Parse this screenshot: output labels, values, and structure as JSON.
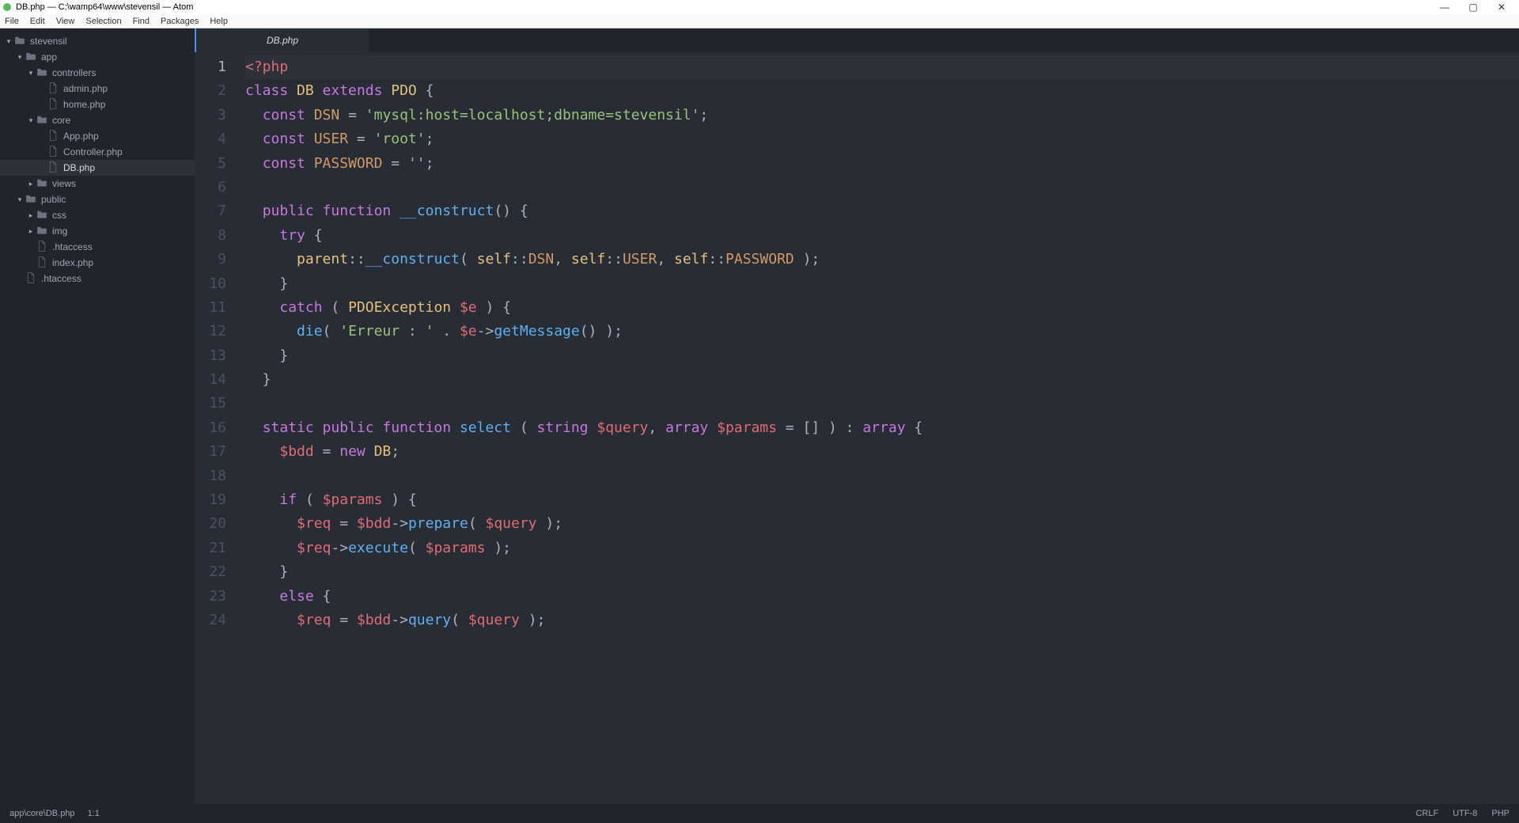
{
  "window": {
    "title": "DB.php — C:\\wamp64\\www\\stevensil — Atom"
  },
  "menu": [
    "File",
    "Edit",
    "View",
    "Selection",
    "Find",
    "Packages",
    "Help"
  ],
  "tree": [
    {
      "depth": 0,
      "kind": "folder",
      "expanded": true,
      "label": "stevensil"
    },
    {
      "depth": 1,
      "kind": "folder",
      "expanded": true,
      "label": "app"
    },
    {
      "depth": 2,
      "kind": "folder",
      "expanded": true,
      "label": "controllers"
    },
    {
      "depth": 3,
      "kind": "file",
      "label": "admin.php"
    },
    {
      "depth": 3,
      "kind": "file",
      "label": "home.php"
    },
    {
      "depth": 2,
      "kind": "folder",
      "expanded": true,
      "label": "core"
    },
    {
      "depth": 3,
      "kind": "file",
      "label": "App.php"
    },
    {
      "depth": 3,
      "kind": "file",
      "label": "Controller.php"
    },
    {
      "depth": 3,
      "kind": "file",
      "label": "DB.php",
      "active": true
    },
    {
      "depth": 2,
      "kind": "folder",
      "expanded": false,
      "label": "views"
    },
    {
      "depth": 1,
      "kind": "folder",
      "expanded": true,
      "label": "public"
    },
    {
      "depth": 2,
      "kind": "folder",
      "expanded": false,
      "label": "css"
    },
    {
      "depth": 2,
      "kind": "folder",
      "expanded": false,
      "label": "img"
    },
    {
      "depth": 2,
      "kind": "file",
      "label": ".htaccess"
    },
    {
      "depth": 2,
      "kind": "file",
      "label": "index.php"
    },
    {
      "depth": 1,
      "kind": "file",
      "label": ".htaccess"
    }
  ],
  "tabs": [
    {
      "label": "DB.php",
      "active": true
    }
  ],
  "editor": {
    "current_line": 1,
    "line_count": 24,
    "lines": [
      [
        {
          "t": "<?php",
          "c": "c-php"
        }
      ],
      [
        {
          "t": "class ",
          "c": "c-key"
        },
        {
          "t": "DB ",
          "c": "c-cls"
        },
        {
          "t": "extends ",
          "c": "c-key"
        },
        {
          "t": "PDO ",
          "c": "c-cls"
        },
        {
          "t": "{",
          "c": "c-punc"
        }
      ],
      [
        {
          "t": "  ",
          "c": ""
        },
        {
          "t": "const ",
          "c": "c-key"
        },
        {
          "t": "DSN ",
          "c": "c-const"
        },
        {
          "t": "= ",
          "c": "c-op"
        },
        {
          "t": "'mysql:host=localhost;dbname=stevensil'",
          "c": "c-str"
        },
        {
          "t": ";",
          "c": "c-punc"
        }
      ],
      [
        {
          "t": "  ",
          "c": ""
        },
        {
          "t": "const ",
          "c": "c-key"
        },
        {
          "t": "USER ",
          "c": "c-const"
        },
        {
          "t": "= ",
          "c": "c-op"
        },
        {
          "t": "'root'",
          "c": "c-str"
        },
        {
          "t": ";",
          "c": "c-punc"
        }
      ],
      [
        {
          "t": "  ",
          "c": ""
        },
        {
          "t": "const ",
          "c": "c-key"
        },
        {
          "t": "PASSWORD ",
          "c": "c-const"
        },
        {
          "t": "= ",
          "c": "c-op"
        },
        {
          "t": "''",
          "c": "c-str"
        },
        {
          "t": ";",
          "c": "c-punc"
        }
      ],
      [
        {
          "t": "",
          "c": ""
        }
      ],
      [
        {
          "t": "  ",
          "c": ""
        },
        {
          "t": "public ",
          "c": "c-key"
        },
        {
          "t": "function ",
          "c": "c-key"
        },
        {
          "t": "__construct",
          "c": "c-fn"
        },
        {
          "t": "() {",
          "c": "c-punc"
        }
      ],
      [
        {
          "t": "    ",
          "c": ""
        },
        {
          "t": "try ",
          "c": "c-key"
        },
        {
          "t": "{",
          "c": "c-punc"
        }
      ],
      [
        {
          "t": "      ",
          "c": ""
        },
        {
          "t": "parent",
          "c": "c-self"
        },
        {
          "t": "::",
          "c": "c-punc"
        },
        {
          "t": "__construct",
          "c": "c-fn"
        },
        {
          "t": "( ",
          "c": "c-punc"
        },
        {
          "t": "self",
          "c": "c-self"
        },
        {
          "t": "::",
          "c": "c-punc"
        },
        {
          "t": "DSN",
          "c": "c-const"
        },
        {
          "t": ", ",
          "c": "c-punc"
        },
        {
          "t": "self",
          "c": "c-self"
        },
        {
          "t": "::",
          "c": "c-punc"
        },
        {
          "t": "USER",
          "c": "c-const"
        },
        {
          "t": ", ",
          "c": "c-punc"
        },
        {
          "t": "self",
          "c": "c-self"
        },
        {
          "t": "::",
          "c": "c-punc"
        },
        {
          "t": "PASSWORD",
          "c": "c-const"
        },
        {
          "t": " );",
          "c": "c-punc"
        }
      ],
      [
        {
          "t": "    }",
          "c": "c-punc"
        }
      ],
      [
        {
          "t": "    ",
          "c": ""
        },
        {
          "t": "catch ",
          "c": "c-key"
        },
        {
          "t": "( ",
          "c": "c-punc"
        },
        {
          "t": "PDOException ",
          "c": "c-cls"
        },
        {
          "t": "$e",
          "c": "c-var"
        },
        {
          "t": " ) {",
          "c": "c-punc"
        }
      ],
      [
        {
          "t": "      ",
          "c": ""
        },
        {
          "t": "die",
          "c": "c-fn"
        },
        {
          "t": "( ",
          "c": "c-punc"
        },
        {
          "t": "'Erreur : '",
          "c": "c-str"
        },
        {
          "t": " . ",
          "c": "c-op"
        },
        {
          "t": "$e",
          "c": "c-var"
        },
        {
          "t": "->",
          "c": "c-op"
        },
        {
          "t": "getMessage",
          "c": "c-fn"
        },
        {
          "t": "() );",
          "c": "c-punc"
        }
      ],
      [
        {
          "t": "    }",
          "c": "c-punc"
        }
      ],
      [
        {
          "t": "  }",
          "c": "c-punc"
        }
      ],
      [
        {
          "t": "",
          "c": ""
        }
      ],
      [
        {
          "t": "  ",
          "c": ""
        },
        {
          "t": "static ",
          "c": "c-key"
        },
        {
          "t": "public ",
          "c": "c-key"
        },
        {
          "t": "function ",
          "c": "c-key"
        },
        {
          "t": "select ",
          "c": "c-fn"
        },
        {
          "t": "( ",
          "c": "c-punc"
        },
        {
          "t": "string ",
          "c": "c-key"
        },
        {
          "t": "$query",
          "c": "c-var"
        },
        {
          "t": ", ",
          "c": "c-punc"
        },
        {
          "t": "array ",
          "c": "c-key"
        },
        {
          "t": "$params",
          "c": "c-var"
        },
        {
          "t": " = [] ) : ",
          "c": "c-op"
        },
        {
          "t": "array ",
          "c": "c-key"
        },
        {
          "t": "{",
          "c": "c-punc"
        }
      ],
      [
        {
          "t": "    ",
          "c": ""
        },
        {
          "t": "$bdd",
          "c": "c-var"
        },
        {
          "t": " = ",
          "c": "c-op"
        },
        {
          "t": "new ",
          "c": "c-key"
        },
        {
          "t": "DB",
          "c": "c-cls"
        },
        {
          "t": ";",
          "c": "c-punc"
        }
      ],
      [
        {
          "t": "",
          "c": ""
        }
      ],
      [
        {
          "t": "    ",
          "c": ""
        },
        {
          "t": "if ",
          "c": "c-key"
        },
        {
          "t": "( ",
          "c": "c-punc"
        },
        {
          "t": "$params",
          "c": "c-var"
        },
        {
          "t": " ) {",
          "c": "c-punc"
        }
      ],
      [
        {
          "t": "      ",
          "c": ""
        },
        {
          "t": "$req",
          "c": "c-var"
        },
        {
          "t": " = ",
          "c": "c-op"
        },
        {
          "t": "$bdd",
          "c": "c-var"
        },
        {
          "t": "->",
          "c": "c-op"
        },
        {
          "t": "prepare",
          "c": "c-fn"
        },
        {
          "t": "( ",
          "c": "c-punc"
        },
        {
          "t": "$query",
          "c": "c-var"
        },
        {
          "t": " );",
          "c": "c-punc"
        }
      ],
      [
        {
          "t": "      ",
          "c": ""
        },
        {
          "t": "$req",
          "c": "c-var"
        },
        {
          "t": "->",
          "c": "c-op"
        },
        {
          "t": "execute",
          "c": "c-fn"
        },
        {
          "t": "( ",
          "c": "c-punc"
        },
        {
          "t": "$params",
          "c": "c-var"
        },
        {
          "t": " );",
          "c": "c-punc"
        }
      ],
      [
        {
          "t": "    }",
          "c": "c-punc"
        }
      ],
      [
        {
          "t": "    ",
          "c": ""
        },
        {
          "t": "else ",
          "c": "c-key"
        },
        {
          "t": "{",
          "c": "c-punc"
        }
      ],
      [
        {
          "t": "      ",
          "c": ""
        },
        {
          "t": "$req",
          "c": "c-var"
        },
        {
          "t": " = ",
          "c": "c-op"
        },
        {
          "t": "$bdd",
          "c": "c-var"
        },
        {
          "t": "->",
          "c": "c-op"
        },
        {
          "t": "query",
          "c": "c-fn"
        },
        {
          "t": "( ",
          "c": "c-punc"
        },
        {
          "t": "$query",
          "c": "c-var"
        },
        {
          "t": " );",
          "c": "c-punc"
        }
      ]
    ]
  },
  "status": {
    "path": "app\\core\\DB.php",
    "cursor": "1:1",
    "line_ending": "CRLF",
    "encoding": "UTF-8",
    "grammar": "PHP"
  }
}
